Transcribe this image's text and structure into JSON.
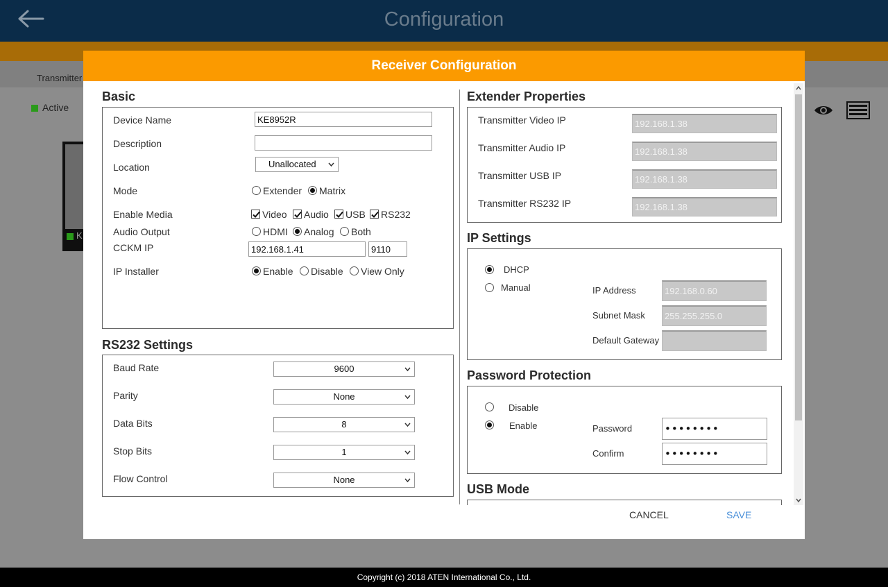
{
  "app": {
    "title": "Configuration",
    "tab_label": "Transmitter",
    "active_label": "Active",
    "device_letter": "K"
  },
  "footer": {
    "text": "Copyright (c) 2018 ATEN International Co., Ltd."
  },
  "modal": {
    "title": "Receiver Configuration",
    "cancel_label": "CANCEL",
    "save_label": "SAVE",
    "basic": {
      "title": "Basic",
      "device_name_label": "Device Name",
      "device_name_value": "KE8952R",
      "description_label": "Description",
      "description_value": "",
      "location_label": "Location",
      "location_value": "Unallocated",
      "mode_label": "Mode",
      "mode_options": [
        "Extender",
        "Matrix"
      ],
      "mode_selected": "Matrix",
      "enable_media_label": "Enable Media",
      "media_options": [
        "Video",
        "Audio",
        "USB",
        "RS232"
      ],
      "audio_output_label": "Audio Output",
      "audio_options": [
        "HDMI",
        "Analog",
        "Both"
      ],
      "audio_selected": "Analog",
      "cckm_ip_label": "CCKM IP",
      "cckm_ip_value": "192.168.1.41",
      "cckm_port_value": "9110",
      "ip_installer_label": "IP Installer",
      "ip_installer_options": [
        "Enable",
        "Disable",
        "View Only"
      ],
      "ip_installer_selected": "Enable"
    },
    "rs232": {
      "title": "RS232 Settings",
      "baud_rate_label": "Baud Rate",
      "baud_rate_value": "9600",
      "parity_label": "Parity",
      "parity_value": "None",
      "data_bits_label": "Data Bits",
      "data_bits_value": "8",
      "stop_bits_label": "Stop Bits",
      "stop_bits_value": "1",
      "flow_control_label": "Flow Control",
      "flow_control_value": "None"
    },
    "extender": {
      "title": "Extender Properties",
      "video_ip_label": "Transmitter Video IP",
      "video_ip_value": "192.168.1.38",
      "audio_ip_label": "Transmitter Audio IP",
      "audio_ip_value": "192.168.1.38",
      "usb_ip_label": "Transmitter USB IP",
      "usb_ip_value": "192.168.1.38",
      "rs232_ip_label": "Transmitter RS232 IP",
      "rs232_ip_value": "192.168.1.38"
    },
    "ip_settings": {
      "title": "IP Settings",
      "dhcp_label": "DHCP",
      "manual_label": "Manual",
      "selected": "DHCP",
      "ip_address_label": "IP Address",
      "ip_address_value": "192.168.0.60",
      "subnet_mask_label": "Subnet Mask",
      "subnet_mask_value": "255.255.255.0",
      "gateway_label": "Default Gateway",
      "gateway_value": ""
    },
    "password": {
      "title": "Password Protection",
      "disable_label": "Disable",
      "enable_label": "Enable",
      "selected": "Enable",
      "password_label": "Password",
      "password_value": "••••••••",
      "confirm_label": "Confirm",
      "confirm_value": "••••••••"
    },
    "usb_mode": {
      "title": "USB Mode"
    }
  },
  "colors": {
    "header_bar": "#0b2c49",
    "modal_header": "#fb9a00",
    "save": "#4a90d9",
    "status_green": "#2a9a1a"
  },
  "icons": [
    "back-arrow-icon",
    "eye-icon",
    "list-icon",
    "chevron-down-icon",
    "checkmark-icon"
  ]
}
